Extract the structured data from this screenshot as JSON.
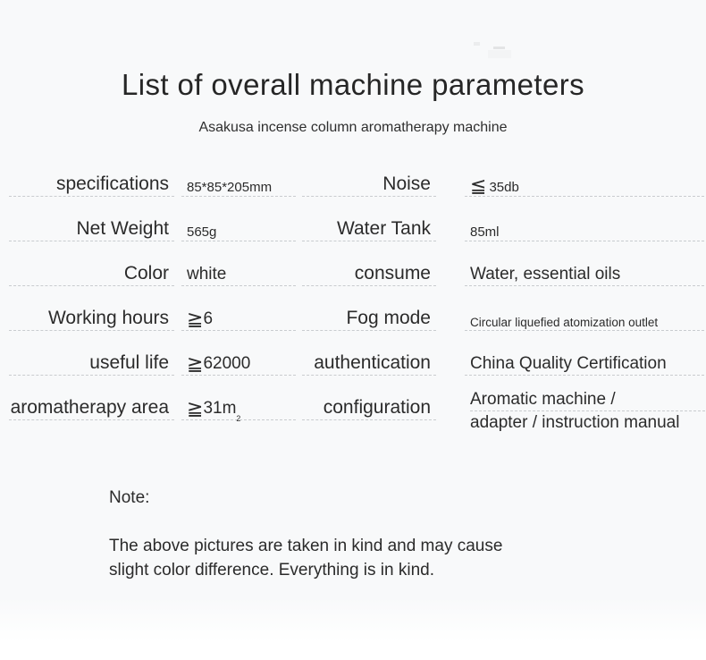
{
  "header": {
    "title": "List of overall machine parameters",
    "subtitle": "Asakusa incense column aromatherapy machine"
  },
  "spec_table": {
    "rows": [
      {
        "left_label": "specifications",
        "left_value": "85*85*205mm",
        "right_label": "Noise",
        "right_value_symbol": "≦",
        "right_value": "35db"
      },
      {
        "left_label": "Net Weight",
        "left_value": "565g",
        "right_label": "Water Tank",
        "right_value": "85ml"
      },
      {
        "left_label": "Color",
        "left_value": "white",
        "right_label": "consume",
        "right_value": "Water, essential oils"
      },
      {
        "left_label": "Working hours",
        "left_value_symbol": "≧",
        "left_value": "6",
        "right_label": "Fog mode",
        "right_value": "Circular liquefied atomization outlet"
      },
      {
        "left_label": "useful life",
        "left_value_symbol": "≧",
        "left_value": "62000",
        "right_label": "authentication",
        "right_value": "China Quality Certification"
      },
      {
        "left_label": "aromatherapy area",
        "left_value_symbol": "≧",
        "left_value": "31m",
        "left_value_superscript": "2",
        "right_label": "configuration",
        "right_value_line1": "Aromatic machine /",
        "right_value_line2": "adapter / instruction manual"
      }
    ]
  },
  "note": {
    "label": "Note:",
    "line1": "The above pictures are taken in kind and may cause",
    "line2": "slight color difference. Everything is in kind."
  },
  "colors": {
    "background": "#f8f9fa",
    "page_white": "#ffffff",
    "text": "#2b2b2b",
    "title_text": "#262626",
    "dashed_rule": "#c9cccf"
  }
}
